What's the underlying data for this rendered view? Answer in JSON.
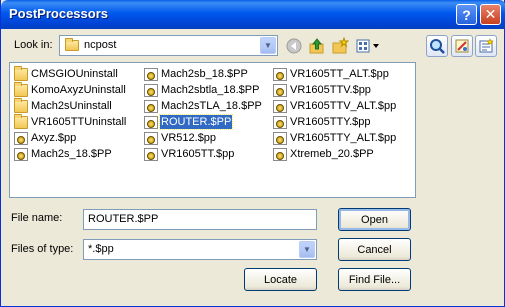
{
  "window": {
    "title": "PostProcessors",
    "help": "?",
    "close": "✕"
  },
  "lookin": {
    "label": "Look in:",
    "value": "ncpost"
  },
  "files": {
    "col1": [
      {
        "name": "CMSGIOUninstall",
        "type": "folder"
      },
      {
        "name": "KomoAxyzUninstall",
        "type": "folder"
      },
      {
        "name": "Mach2sUninstall",
        "type": "folder"
      },
      {
        "name": "VR1605TTUninstall",
        "type": "folder"
      },
      {
        "name": "Axyz.$pp",
        "type": "pp"
      },
      {
        "name": "Mach2s_18.$PP",
        "type": "pp"
      }
    ],
    "col2": [
      {
        "name": "Mach2sb_18.$PP",
        "type": "pp"
      },
      {
        "name": "Mach2sbtla_18.$PP",
        "type": "pp"
      },
      {
        "name": "Mach2sTLA_18.$PP",
        "type": "pp"
      },
      {
        "name": "ROUTER.$PP",
        "type": "pp",
        "selected": true
      },
      {
        "name": "VR512.$pp",
        "type": "pp"
      },
      {
        "name": "VR1605TT.$pp",
        "type": "pp"
      }
    ],
    "col3": [
      {
        "name": "VR1605TT_ALT.$pp",
        "type": "pp"
      },
      {
        "name": "VR1605TTV.$pp",
        "type": "pp"
      },
      {
        "name": "VR1605TTV_ALT.$pp",
        "type": "pp"
      },
      {
        "name": "VR1605TTY.$pp",
        "type": "pp"
      },
      {
        "name": "VR1605TTY_ALT.$pp",
        "type": "pp"
      },
      {
        "name": "Xtremeb_20.$PP",
        "type": "pp"
      }
    ]
  },
  "filename": {
    "label": "File name:",
    "value": "ROUTER.$PP"
  },
  "filetype": {
    "label": "Files of type:",
    "value": "*.$pp"
  },
  "buttons": {
    "open": "Open",
    "cancel": "Cancel",
    "locate": "Locate",
    "find": "Find File..."
  }
}
